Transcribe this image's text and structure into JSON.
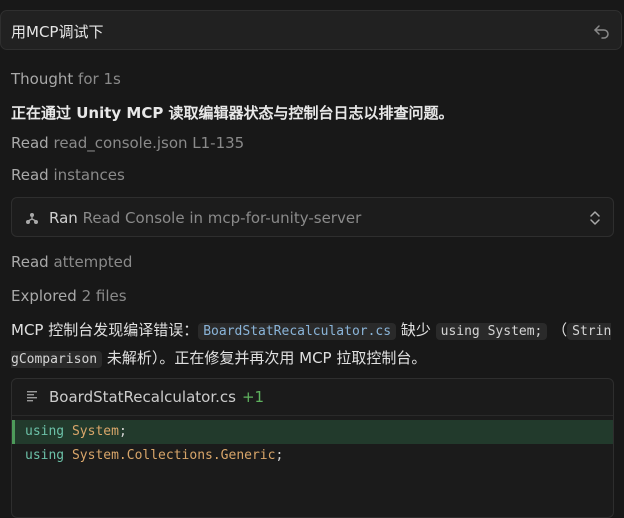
{
  "header": {
    "title": "用MCP调试下"
  },
  "thought": {
    "label": "Thought",
    "duration": "for 1s"
  },
  "status_line": "正在通过 Unity MCP 读取编辑器状态与控制台日志以排查问题。",
  "read1": {
    "verb": "Read",
    "target": "read_console.json L1-135"
  },
  "read2": {
    "verb": "Read",
    "target": "instances"
  },
  "tool_call": {
    "verb": "Ran",
    "text": "Read Console in mcp-for-unity-server"
  },
  "read3": {
    "verb": "Read",
    "target": "attempted"
  },
  "explored": {
    "verb": "Explored",
    "target": "2 files"
  },
  "message": {
    "part1": "MCP 控制台发现编译错误：",
    "file_code": "BoardStatRecalculator.cs",
    "part2": " 缺少 ",
    "using_code": "using System;",
    "part3": " （",
    "cmp_code": "StringComparison",
    "part4": " 未解析）。正在修复并再次用 MCP 拉取控制台。"
  },
  "code_block": {
    "filename": "BoardStatRecalculator.cs",
    "changes": "+1",
    "lines": [
      {
        "kw": "using",
        "ns": "System",
        "end": ";"
      },
      {
        "kw": "using",
        "ns": "System.Collections.Generic",
        "end": ";"
      }
    ]
  },
  "colors": {
    "background": "#181818",
    "added_line": "#223a2c",
    "accent_green": "#5fb35f"
  },
  "icons": {
    "undo": "undo-icon",
    "tool": "tool-icon",
    "chevron": "chevron-updown-icon",
    "file": "file-lines-icon"
  }
}
